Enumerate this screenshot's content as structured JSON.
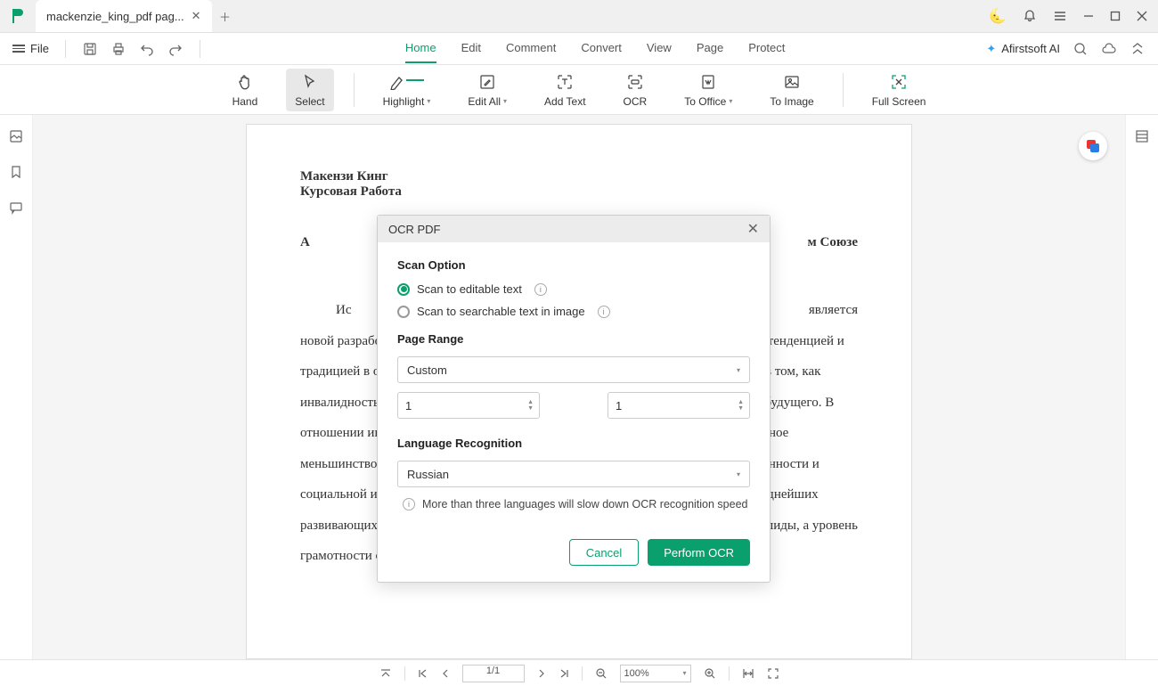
{
  "titlebar": {
    "tab_title": "mackenzie_king_pdf pag..."
  },
  "menubar": {
    "file": "File",
    "tabs": [
      "Home",
      "Edit",
      "Comment",
      "Convert",
      "View",
      "Page",
      "Protect"
    ],
    "active_tab": "Home",
    "ai_label": "Afirstsoft AI"
  },
  "toolbar": {
    "items": [
      {
        "label": "Hand"
      },
      {
        "label": "Select"
      },
      {
        "label": "Highlight",
        "caret": true
      },
      {
        "label": "Edit All",
        "caret": true
      },
      {
        "label": "Add Text"
      },
      {
        "label": "OCR"
      },
      {
        "label": "To Office",
        "caret": true
      },
      {
        "label": "To Image"
      },
      {
        "label": "Full Screen"
      }
    ]
  },
  "document": {
    "author_line1": "Макензи Кинг",
    "author_line2": "Курсовая Работа",
    "title_left": "А",
    "title_right": "м Союзе",
    "body_frag_top": "Ис",
    "body_frag_top_right": "является",
    "body": "новой разработкой. Тем не менее, этот предмет остается недостаточно изученной тенденцией и традицией в области исследований меньшинств – в нашей работе и нашей науке, в том, как инвалидность может понимать наше прошлое, настоящее и возможности нашего будущего. В отношении инвалидности статистические данные показывают самое многочисленное меньшинство в мире, наиболее неблагоприятное положение в результате обездоленности и социальной изоляции. Погибают из-за нехватки санитарии и чистой воды, 98% беднейших развивающихся странах не ходят в школу, около трети беспризорных детей - инвалиды, а уровень грамотности среди взрослых инвалидов в некоторых странах"
  },
  "dialog": {
    "title": "OCR PDF",
    "scan_option_label": "Scan Option",
    "radio1": "Scan to editable text",
    "radio2": "Scan to searchable text in image",
    "page_range_label": "Page Range",
    "range_select": "Custom",
    "range_from": "1",
    "range_to": "1",
    "lang_label": "Language Recognition",
    "lang_select": "Russian",
    "hint": "More than three languages will slow down OCR recognition speed",
    "cancel": "Cancel",
    "perform": "Perform OCR"
  },
  "bottombar": {
    "page": "1/1",
    "zoom": "100%"
  }
}
